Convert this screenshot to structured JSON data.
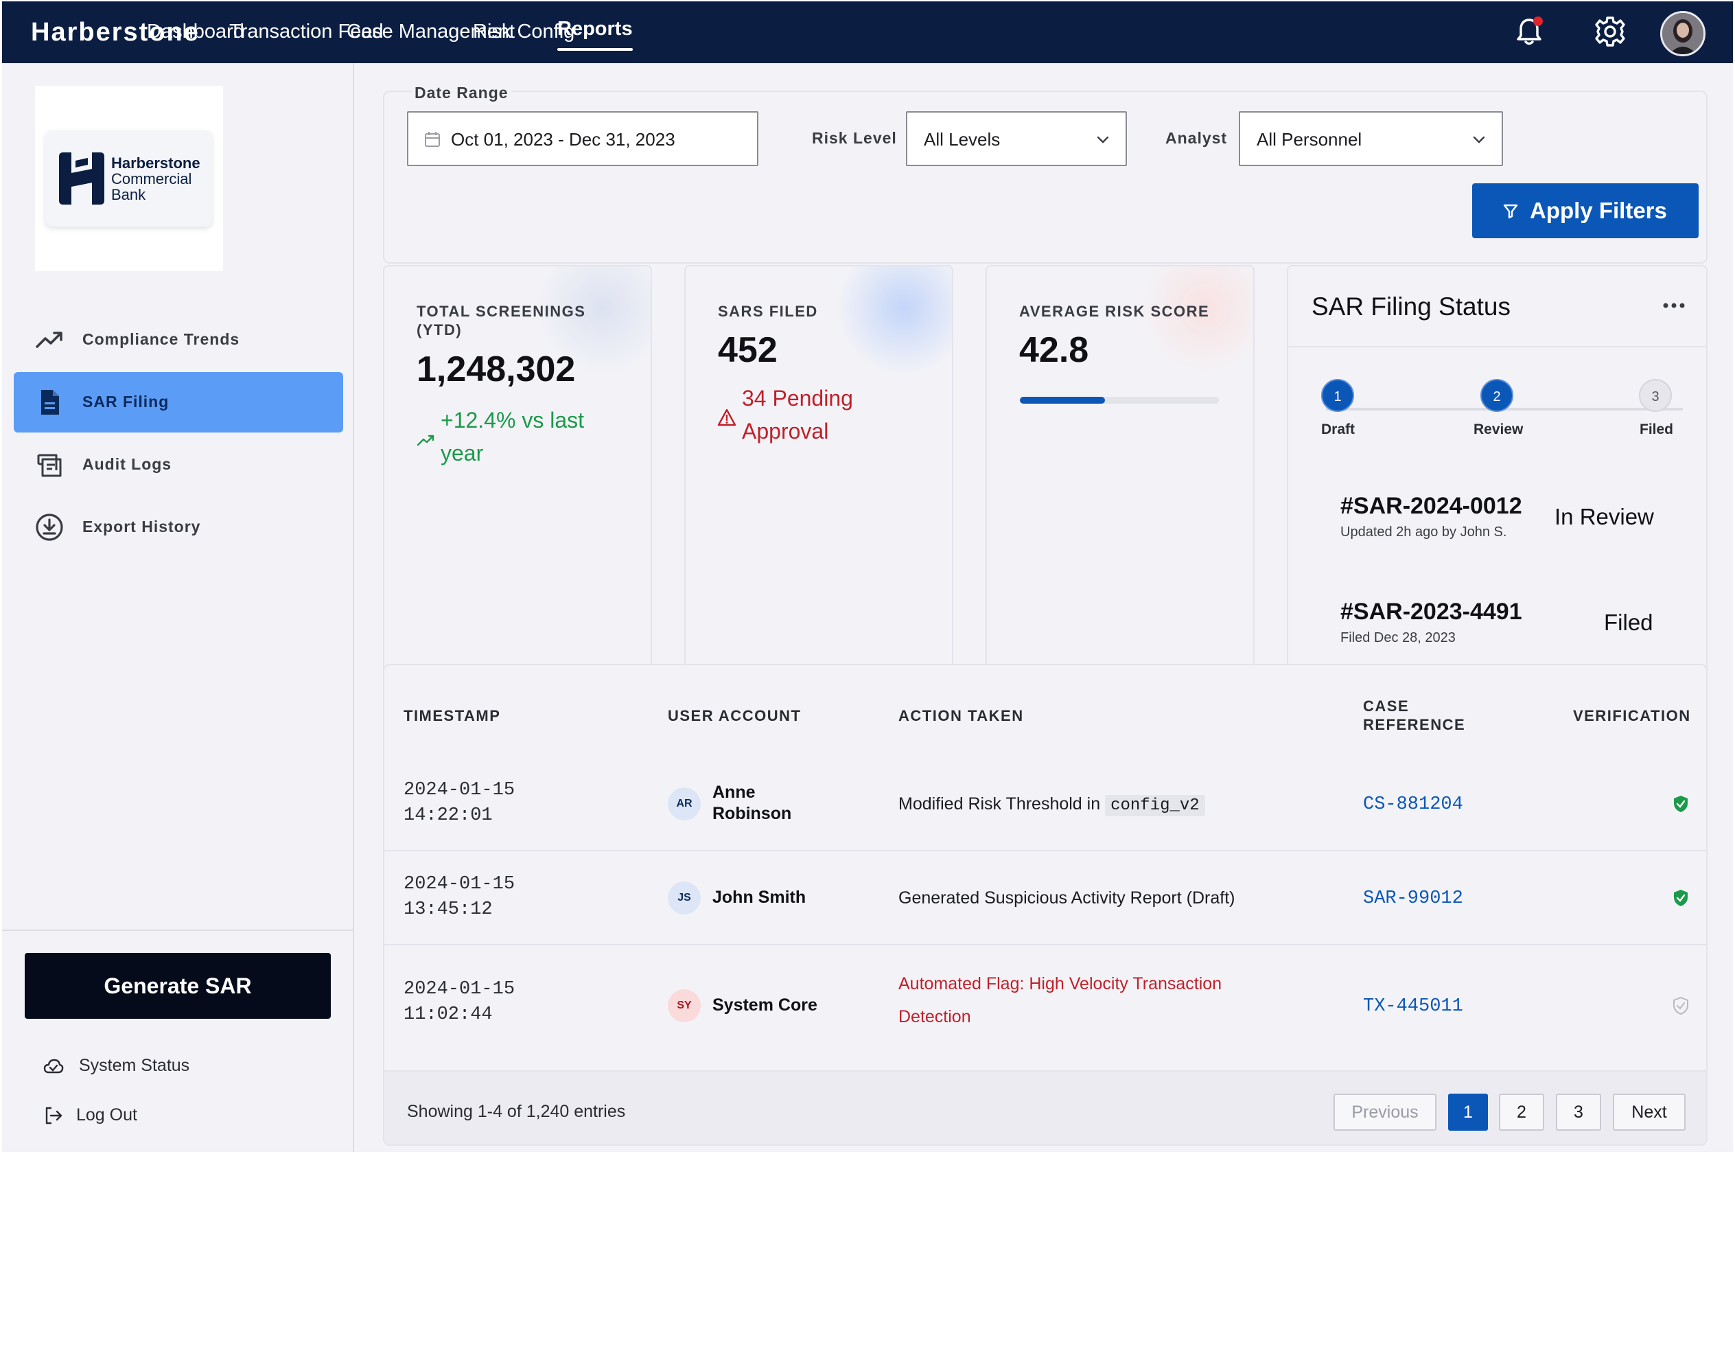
{
  "topbar": {
    "brand": "Harberstone",
    "nav": [
      "Dashboard",
      "Transaction Feed",
      "Case Management",
      "Risk Config",
      "Reports"
    ],
    "active_nav": "Reports",
    "icons": [
      "notification-bell-icon",
      "gear-icon",
      "user-avatar"
    ],
    "notification_dot_color": "#e0242e"
  },
  "sidebar": {
    "logo": {
      "line1": "Harberstone",
      "line2": "Commercial",
      "line3": "Bank"
    },
    "items": [
      {
        "label": "Compliance Trends",
        "icon": "trending-up-icon",
        "active": false
      },
      {
        "label": "SAR Filing",
        "icon": "document-icon",
        "active": true
      },
      {
        "label": "Audit Logs",
        "icon": "audit-log-icon",
        "active": false
      },
      {
        "label": "Export History",
        "icon": "download-circle-icon",
        "active": false
      }
    ],
    "generate_button": "Generate SAR",
    "footer": [
      {
        "label": "System Status",
        "icon": "cloud-check-icon"
      },
      {
        "label": "Log Out",
        "icon": "logout-icon"
      }
    ]
  },
  "filters": {
    "date_label": "Date Range",
    "date_value": "Oct 01, 2023 - Dec 31, 2023",
    "risk_label": "Risk Level",
    "risk_value": "All Levels",
    "analyst_label": "Analyst",
    "analyst_value": "All Personnel",
    "apply_label": "Apply Filters"
  },
  "metrics": {
    "screenings": {
      "title_line1": "TOTAL SCREENINGS",
      "title_line2": "(YTD)",
      "value": "1,248,302",
      "delta_line1": "+12.4% vs last",
      "delta_line2": "year"
    },
    "sars": {
      "title": "SARS FILED",
      "value": "452",
      "pending_line1": "34 Pending",
      "pending_line2": "Approval"
    },
    "risk": {
      "title": "AVERAGE RISK SCORE",
      "value": "42.8",
      "progress": 0.428
    }
  },
  "sar_status": {
    "title": "SAR Filing Status",
    "steps": [
      {
        "num": "1",
        "label": "Draft",
        "done": true
      },
      {
        "num": "2",
        "label": "Review",
        "done": true
      },
      {
        "num": "3",
        "label": "Filed",
        "done": false
      }
    ],
    "items": [
      {
        "id": "#SAR-2024-0012",
        "meta": "Updated 2h ago by John S.",
        "state": "In Review"
      },
      {
        "id": "#SAR-2023-4491",
        "meta": "Filed Dec 28, 2023",
        "state": "Filed"
      }
    ]
  },
  "audit": {
    "headers": {
      "timestamp": "TIMESTAMP",
      "user": "USER ACCOUNT",
      "action": "ACTION TAKEN",
      "case_line1": "CASE",
      "case_line2": "REFERENCE",
      "verification": "VERIFICATION"
    },
    "rows": [
      {
        "date": "2024-01-15",
        "time": "14:22:01",
        "initials": "AR",
        "name_line1": "Anne",
        "name_line2": "Robinson",
        "action": "Modified Risk Threshold in",
        "action_code": "config_v2",
        "case": "CS-881204",
        "verified": true
      },
      {
        "date": "2024-01-15",
        "time": "13:45:12",
        "initials": "JS",
        "name_line1": "John Smith",
        "action": "Generated Suspicious Activity Report (Draft)",
        "case": "SAR-99012",
        "verified": true
      },
      {
        "date": "2024-01-15",
        "time": "11:02:44",
        "initials": "SY",
        "name_line1": "System Core",
        "action_line1": "Automated Flag: High Velocity Transaction",
        "action_line2": "Detection",
        "case": "TX-445011",
        "verified": false
      }
    ],
    "showing": "Showing 1-4 of 1,240 entries",
    "pagination": {
      "previous": "Previous",
      "pages": [
        "1",
        "2",
        "3"
      ],
      "current": "1",
      "next": "Next"
    }
  },
  "colors": {
    "topbar": "#0b1e42",
    "accent": "#0b57b8",
    "sidebar_active": "#5b9cf6",
    "positive": "#1a9a4a",
    "alert": "#c0202a",
    "verified": "#1a9a4a"
  }
}
